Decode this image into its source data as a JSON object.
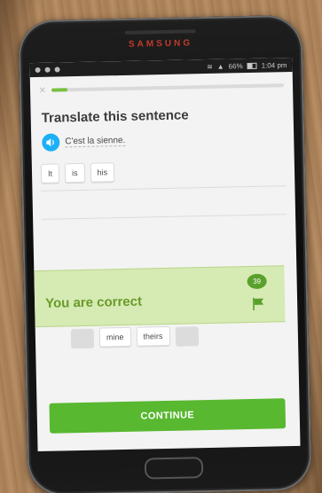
{
  "device": {
    "brand": "SAMSUNG"
  },
  "status_bar": {
    "battery": "66%",
    "time": "1:04 pm"
  },
  "lesson": {
    "progress_fraction": 0.07,
    "title": "Translate this sentence",
    "prompt": "C'est la sienne.",
    "answer_tokens": [
      "It",
      "is",
      "his"
    ],
    "word_bank": [
      "mine",
      "theirs"
    ]
  },
  "feedback": {
    "message": "You are correct",
    "discussion_count": "39"
  },
  "continue_label": "CONTINUE",
  "colors": {
    "accent_green": "#58b830",
    "banner_bg": "#d6eab4",
    "banner_text": "#6a9b29",
    "speaker_blue": "#1cb0f6"
  },
  "icons": {
    "close": "close-icon",
    "speaker": "speaker-icon",
    "discussion": "speech-bubble-icon",
    "report": "flag-icon"
  }
}
